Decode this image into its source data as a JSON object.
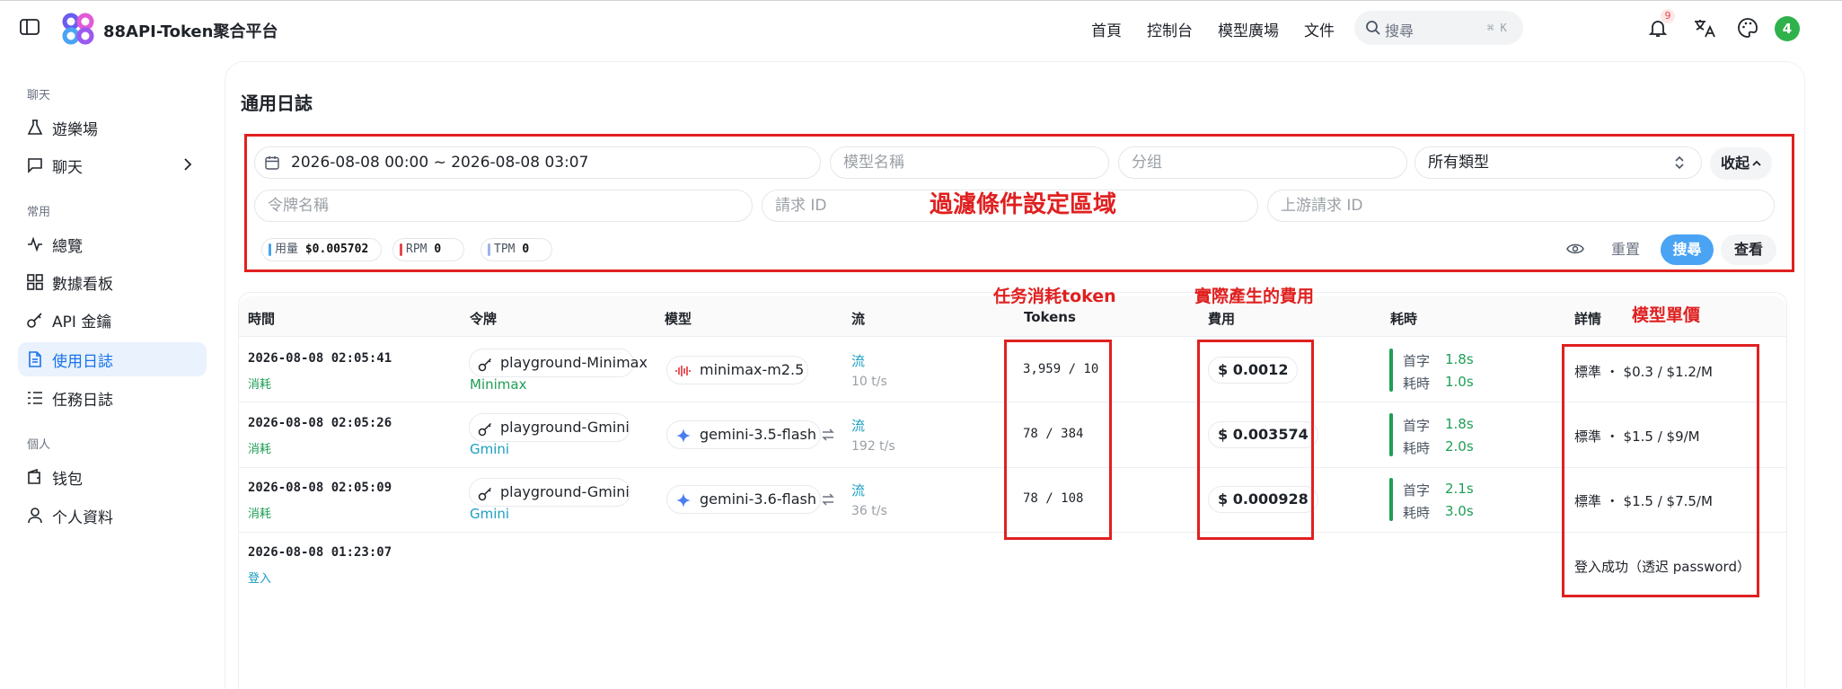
{
  "app": {
    "title": "88API-Token聚合平台"
  },
  "top_nav": [
    "首頁",
    "控制台",
    "模型廣場",
    "文件"
  ],
  "search": {
    "label": "搜尋",
    "shortcut": "⌘ K"
  },
  "notifications": {
    "count": "9"
  },
  "user": {
    "avatar_text": "4"
  },
  "sidebar": {
    "sections": [
      {
        "title": "聊天",
        "items": [
          {
            "label": "遊樂場",
            "icon": "flask-icon"
          },
          {
            "label": "聊天",
            "icon": "chat-icon",
            "has_submenu": true
          }
        ]
      },
      {
        "title": "常用",
        "items": [
          {
            "label": "總覽",
            "icon": "activity-icon"
          },
          {
            "label": "數據看板",
            "icon": "grid-icon"
          },
          {
            "label": "API 金鑰",
            "icon": "key-icon"
          },
          {
            "label": "使用日誌",
            "icon": "document-icon",
            "active": true
          },
          {
            "label": "任務日誌",
            "icon": "list-icon"
          }
        ]
      },
      {
        "title": "個人",
        "items": [
          {
            "label": "钱包",
            "icon": "wallet-icon"
          },
          {
            "label": "个人資料",
            "icon": "user-icon"
          }
        ]
      }
    ]
  },
  "page": {
    "title": "通用日誌"
  },
  "filters": {
    "date_range": "2026-08-08 00:00 ~ 2026-08-08 03:07",
    "model_placeholder": "模型名稱",
    "group_placeholder": "分组",
    "type_select": "所有類型",
    "collapse_label": "收起",
    "token_placeholder": "令牌名稱",
    "request_id_placeholder": "請求 ID",
    "upstream_id_placeholder": "上游請求 ID",
    "stats": [
      {
        "label": "用量",
        "value": "$0.005702",
        "color": "#4aa3f3"
      },
      {
        "label": "RPM",
        "value": "0",
        "color": "#e5484d"
      },
      {
        "label": "TPM",
        "value": "0",
        "color": "#9bb5e0"
      }
    ],
    "reset_label": "重置",
    "search_label": "搜尋",
    "view_label": "查看"
  },
  "table": {
    "headers": [
      "時間",
      "令牌",
      "模型",
      "流",
      "Tokens",
      "費用",
      "耗時",
      "詳情"
    ],
    "rows": [
      {
        "time": "2026-08-08 02:05:41",
        "type": "消耗",
        "token": "playground-Minimax",
        "token_group": "Minimax",
        "model": "minimax-m2.5",
        "model_icon": "minimax-icon",
        "flow": "流",
        "speed": "10 t/s",
        "tokens": "3,959 / 10",
        "cost": "$ 0.0012",
        "first_label": "首字",
        "first_val": "1.8s",
        "total_label": "耗時",
        "total_val": "1.0s",
        "detail": "標準 ・ $0.3 / $1.2/M"
      },
      {
        "time": "2026-08-08 02:05:26",
        "type": "消耗",
        "token": "playground-Gmini",
        "token_group": "Gmini",
        "model": "gemini-3.5-flash",
        "model_icon": "gemini-icon",
        "flow": "流",
        "speed": "192 t/s",
        "tokens": "78 / 384",
        "cost": "$ 0.003574",
        "first_label": "首字",
        "first_val": "1.8s",
        "total_label": "耗時",
        "total_val": "2.0s",
        "detail": "標準 ・ $1.5 / $9/M"
      },
      {
        "time": "2026-08-08 02:05:09",
        "type": "消耗",
        "token": "playground-Gmini",
        "token_group": "Gmini",
        "model": "gemini-3.6-flash",
        "model_icon": "gemini-icon",
        "flow": "流",
        "speed": "36 t/s",
        "tokens": "78 / 108",
        "cost": "$ 0.000928",
        "first_label": "首字",
        "first_val": "2.1s",
        "total_label": "耗時",
        "total_val": "3.0s",
        "detail": "標準 ・ $1.5 / $7.5/M"
      },
      {
        "time": "2026-08-08 01:23:07",
        "type": "登入",
        "detail": "登入成功（透迟 password）"
      }
    ]
  },
  "annotations": {
    "filter_area": "過濾條件設定區域",
    "tokens": "任务消耗token",
    "cost": "實際產生的費用",
    "unit_price": "模型單價",
    "color": "#e02020"
  }
}
